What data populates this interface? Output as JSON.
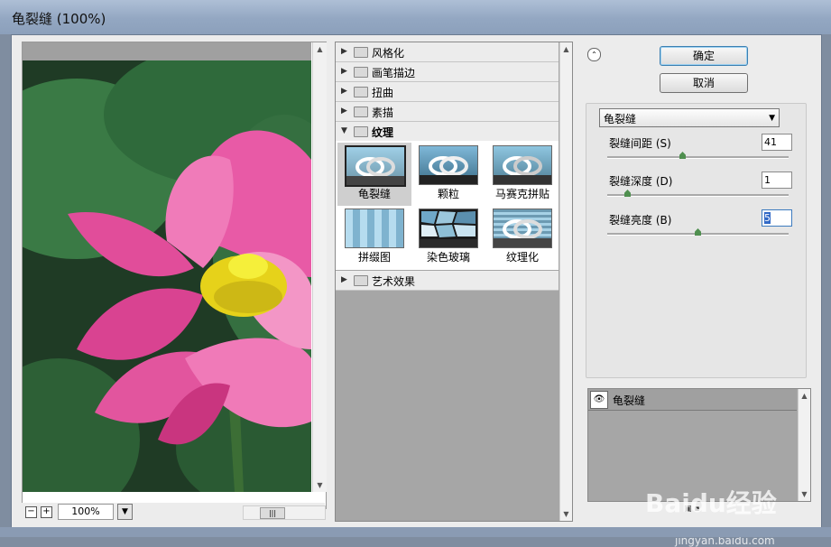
{
  "window": {
    "title": "龟裂缝 (100%)"
  },
  "preview": {
    "zoom_value": "100%",
    "zoom_minus": "−",
    "zoom_plus": "+"
  },
  "categories": [
    {
      "label": "风格化",
      "expanded": false
    },
    {
      "label": "画笔描边",
      "expanded": false
    },
    {
      "label": "扭曲",
      "expanded": false
    },
    {
      "label": "素描",
      "expanded": false
    },
    {
      "label": "纹理",
      "expanded": true
    },
    {
      "label": "艺术效果",
      "expanded": false
    }
  ],
  "texture_filters": [
    {
      "label": "龟裂缝",
      "selected": true
    },
    {
      "label": "颗粒",
      "selected": false
    },
    {
      "label": "马赛克拼贴",
      "selected": false
    },
    {
      "label": "拼缀图",
      "selected": false
    },
    {
      "label": "染色玻璃",
      "selected": false
    },
    {
      "label": "纹理化",
      "selected": false
    }
  ],
  "buttons": {
    "ok": "确定",
    "cancel": "取消"
  },
  "filter_select": {
    "selected": "龟裂缝"
  },
  "params": [
    {
      "label": "裂缝间距 (S)",
      "value": "41",
      "slider": 0.41
    },
    {
      "label": "裂缝深度 (D)",
      "value": "1",
      "slider": 0.1
    },
    {
      "label": "裂缝亮度 (B)",
      "value": "5",
      "slider": 0.5
    }
  ],
  "layers": {
    "effect_label": "龟裂缝"
  },
  "watermark": {
    "text": "Baidu经验",
    "sub": "jingyan.baidu.com"
  },
  "colors": {
    "accent_green": "#4f8f4f",
    "focus_blue": "#3169c6",
    "petal_pink": "#e84c9c"
  }
}
